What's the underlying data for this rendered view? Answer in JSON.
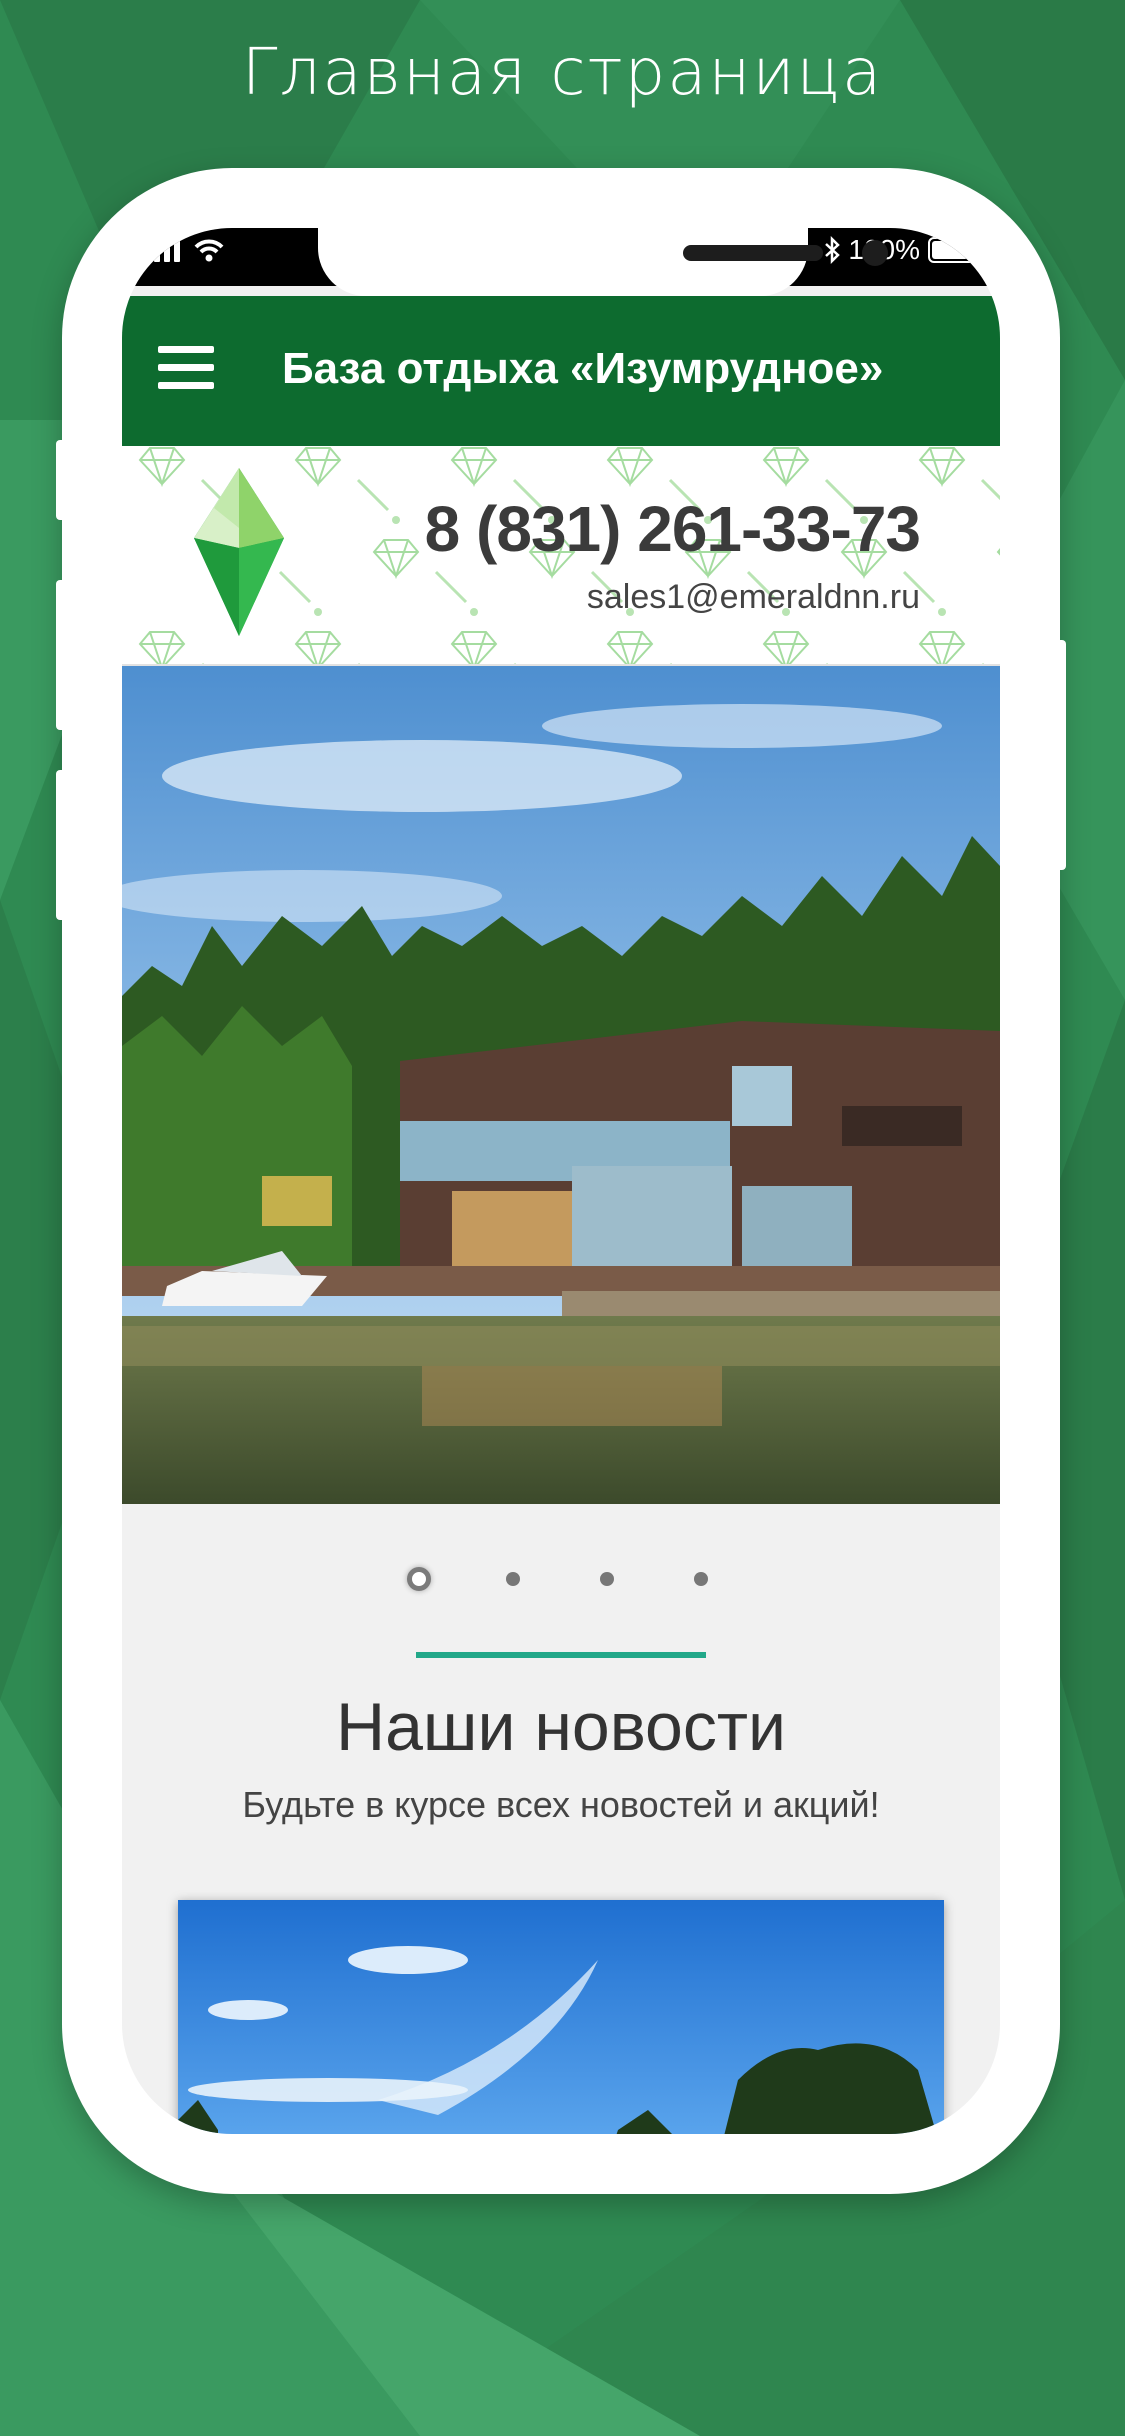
{
  "caption": "Главная  страница",
  "status_bar": {
    "battery_text": "100%",
    "battery_level": 1.0,
    "icons": [
      "signal-icon",
      "wifi-icon",
      "bluetooth-icon",
      "battery-icon"
    ]
  },
  "app_bar": {
    "menu_icon": "hamburger-menu-icon",
    "title": "База отдыха «Изумрудное»"
  },
  "header": {
    "logo": "emerald-logo",
    "phone": "8 (831) 261-33-73",
    "email": "sales1@emeraldnn.ru"
  },
  "carousel": {
    "slide_count": 4,
    "active_index": 0,
    "image": "lakeside-hotel-photo"
  },
  "news": {
    "title": "Наши новости",
    "subtitle": "Будьте в курсе всех новостей и акций!",
    "card_image": "sky-trees-photo"
  },
  "colors": {
    "background": "#2f8a52",
    "app_bar": "#0d6b2f",
    "accent": "#23a889",
    "logo_green": "#3cc15a"
  }
}
